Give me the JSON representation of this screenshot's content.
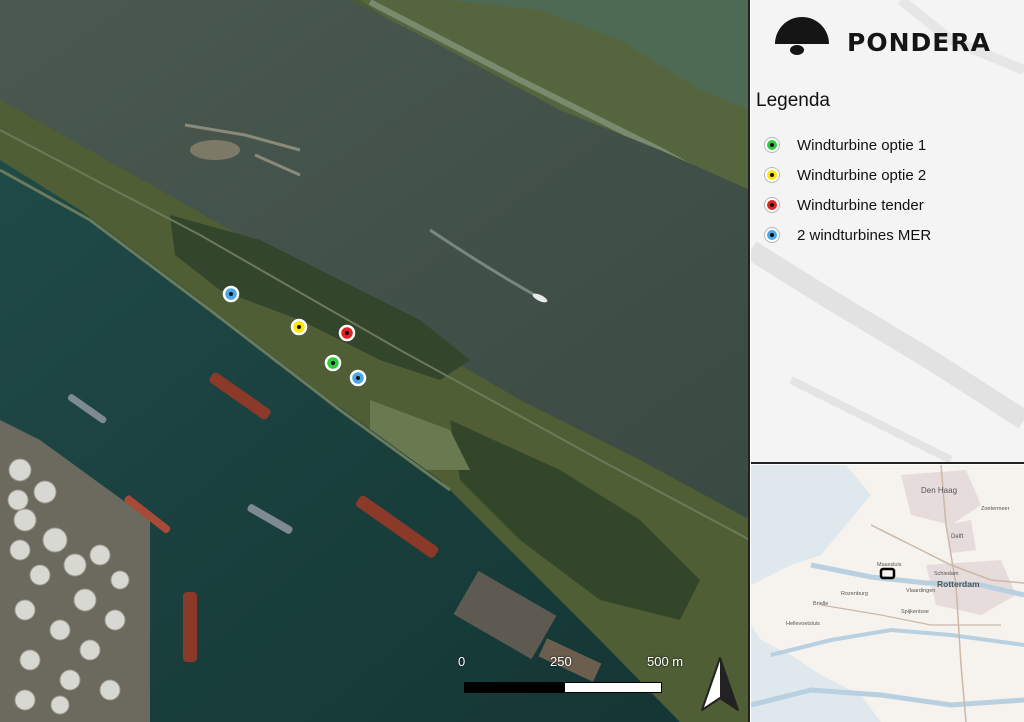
{
  "logo": {
    "brand_name": "PONDERA",
    "icon": "pondera-logo-icon"
  },
  "legend": {
    "title": "Legenda",
    "items": [
      {
        "label": "Windturbine optie 1",
        "color": "#2ecc40"
      },
      {
        "label": "Windturbine optie 2",
        "color": "#ffe600"
      },
      {
        "label": "Windturbine tender",
        "color": "#e52222"
      },
      {
        "label": "2 windturbines MER",
        "color": "#4aa8e8"
      }
    ]
  },
  "scalebar": {
    "labels": [
      "0",
      "250",
      "500 m"
    ]
  },
  "north_arrow": {
    "icon": "north-arrow-icon"
  },
  "inset_map": {
    "place_labels": [
      "Den Haag",
      "Rotterdam",
      "Delft",
      "Schiedam",
      "Vlaardingen",
      "Maassluis",
      "Zoetermeer",
      "Rozenburg",
      "Spijkenisse",
      "Hellevoetsluis",
      "Brielle"
    ],
    "locator": "locator-rectangle"
  },
  "colors": {
    "river": "#3c4d44",
    "harbour": "#18403f",
    "land": "#4a5a35",
    "panel": "#f4f4f4"
  }
}
